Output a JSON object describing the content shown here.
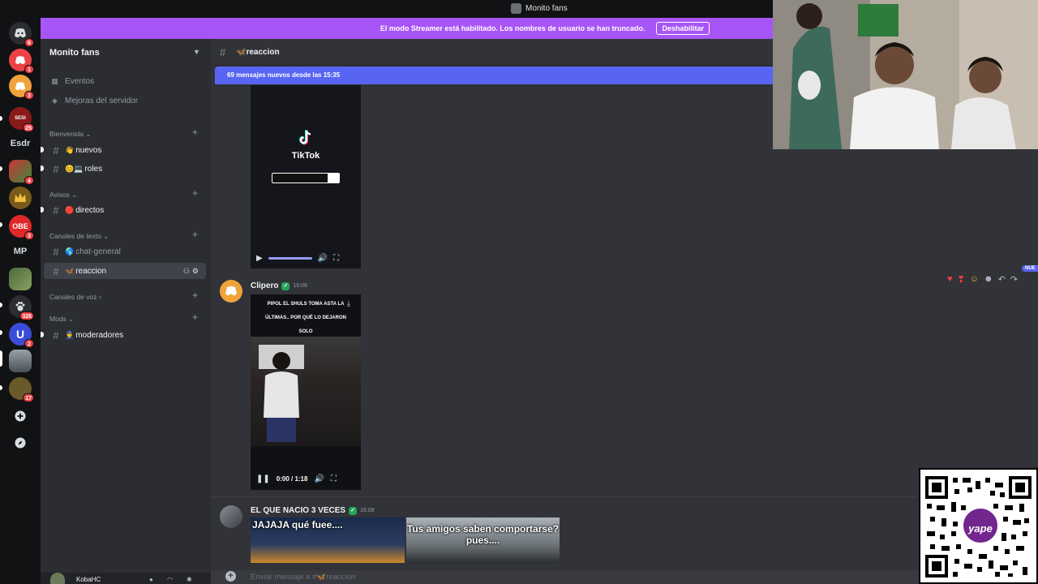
{
  "window": {
    "title": "Monito fans"
  },
  "banner": {
    "text": "El modo Streamer está habilitado. Los nombres de usuario se han truncado.",
    "button": "Deshabilitar",
    "color": "#a855f7"
  },
  "rail": {
    "servers": [
      {
        "name": "discord-home",
        "badge": "6",
        "color": "#2b2d31"
      },
      {
        "name": "server-1",
        "badge": "1",
        "color": "#ed4245"
      },
      {
        "name": "server-2",
        "badge": "3",
        "color": "#f0a33a"
      },
      {
        "name": "server-3",
        "badge": "25",
        "color": "#8a1a1a"
      },
      {
        "name": "server-5",
        "badge": "4",
        "color": "#3b8a3b"
      },
      {
        "name": "server-6",
        "badge": "",
        "color": "#7a5a1a"
      },
      {
        "name": "server-7",
        "badge": "3",
        "color": "#e0272a"
      },
      {
        "name": "server-9",
        "badge": "",
        "color": "#4a6a3a"
      },
      {
        "name": "server-10",
        "badge": "326",
        "color": "#2b2d31"
      },
      {
        "name": "server-11",
        "badge": "2",
        "color": "#3a4cd8"
      },
      {
        "name": "server-12",
        "badge": "",
        "color": "#5a6070"
      },
      {
        "name": "server-13",
        "badge": "17",
        "color": "#6a5a2a"
      }
    ],
    "text_servers": [
      "Esdr",
      "MP"
    ],
    "server_labels": {
      "server-3": "SESI",
      "server-7": "OBE",
      "server-11": "U"
    }
  },
  "sidebar": {
    "server_name": "Monito fans",
    "nav": [
      {
        "label": "Eventos",
        "icon": "calendar-icon"
      },
      {
        "label": "Mejoras del servidor",
        "icon": "boost-icon"
      }
    ],
    "categories": {
      "bienvenida": "Bienvenida",
      "avisos": "Avisos",
      "texto": "Canales de texto",
      "voz": "Canales de voz",
      "mods": "Mods"
    },
    "channels": {
      "nuevos": {
        "emoji": "👋",
        "label": "nuevos"
      },
      "roles": {
        "emoji": "😊💻",
        "label": "roles"
      },
      "directos": {
        "emoji": "🔴",
        "label": "directos"
      },
      "chat_general": {
        "emoji": "🌎",
        "label": "chat-general"
      },
      "reaccion": {
        "emoji": "🦋",
        "label": "reaccion"
      },
      "moderadores": {
        "emoji": "👮",
        "label": "moderadores"
      }
    },
    "user": {
      "name": "KobaHC"
    }
  },
  "chat": {
    "channel_name": "reaccion",
    "new_messages_bar": "69 mensajes nuevos desde las 15:35",
    "tiktok": {
      "brand": "TikTok"
    },
    "messages": [
      {
        "author": "Clipero",
        "time": "16:08",
        "video_caption_lines": [
          "PIPOL EL SHULS TOMA ASTA LA",
          "ÚLTIMAS.. POR QUÉ LO DEJARON",
          "SOLO"
        ],
        "video_time": "0:00 / 1:18"
      },
      {
        "author": "EL QUE NACIO 3 VECES",
        "time": "16:08",
        "thumb_a_caption": "JAJAJA qué fuee....",
        "thumb_b_caption": "Tus amigos saben comportarse? pues...."
      }
    ],
    "reaction_badge": "NUE",
    "composer_placeholder": "Enviar mensaje a #🦋reaccion"
  },
  "overlay": {
    "qr_brand": "yape"
  }
}
